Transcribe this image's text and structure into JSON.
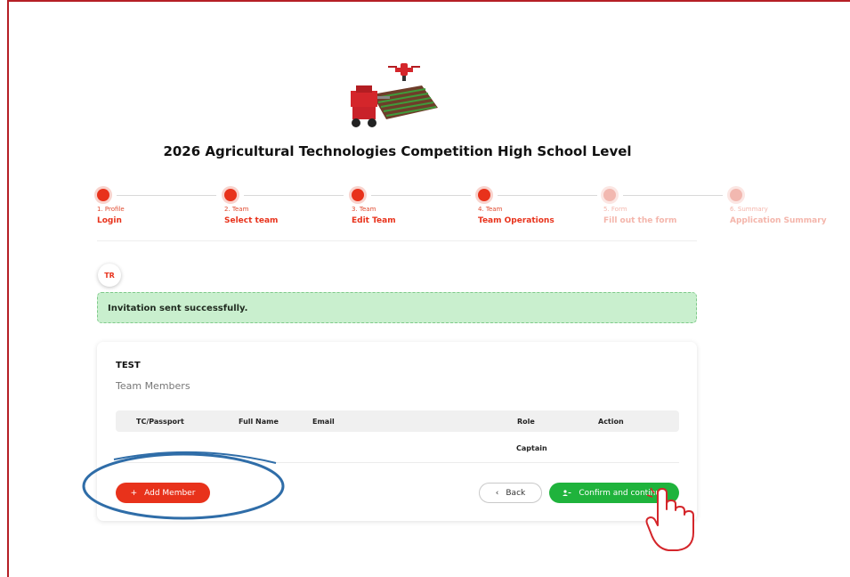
{
  "page": {
    "title": "2026 Agricultural Technologies Competition High School Level"
  },
  "stepper": [
    {
      "sub": "1. Profile",
      "label": "Login",
      "state": "done"
    },
    {
      "sub": "2. Team",
      "label": "Select team",
      "state": "done"
    },
    {
      "sub": "3. Team",
      "label": "Edit Team",
      "state": "done"
    },
    {
      "sub": "4. Team",
      "label": "Team Operations",
      "state": "current"
    },
    {
      "sub": "5. Form",
      "label": "Fill out the form",
      "state": "pending"
    },
    {
      "sub": "6. Summary",
      "label": "Application Summary",
      "state": "pending"
    }
  ],
  "user": {
    "initials": "TR"
  },
  "alert": {
    "message": "Invitation sent successfully.",
    "color": "#c9efce"
  },
  "team": {
    "name": "TEST",
    "section_label": "Team Members",
    "columns": [
      "TC/Passport",
      "Full Name",
      "Email",
      "Role",
      "Action"
    ],
    "rows": [
      {
        "tc": "",
        "full_name": "",
        "email": "",
        "role": "Captain",
        "action": ""
      }
    ]
  },
  "actions": {
    "add_member": "Add Member",
    "back": "Back",
    "confirm": "Confirm and continue"
  },
  "icons": {
    "add": "plus-icon",
    "back": "chevron-left-icon",
    "confirm": "users-icon"
  },
  "colors": {
    "brand_red": "#e8321b",
    "success_green": "#1fb33c",
    "annotation_blue": "#2f6da8"
  }
}
